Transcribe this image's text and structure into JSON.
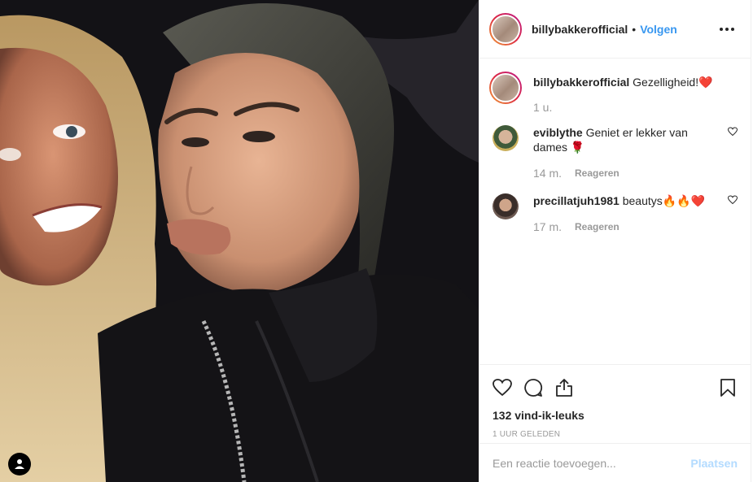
{
  "post": {
    "author": "billybakkerofficial",
    "separator": "•",
    "follow_label": "Volgen",
    "caption": "Gezelligheid!❤️",
    "caption_age": "1 u."
  },
  "comments": [
    {
      "user": "eviblythe",
      "text": "Geniet er lekker van dames 🌹",
      "age": "14 m.",
      "reply_label": "Reageren"
    },
    {
      "user": "precillatjuh1981",
      "text": "beautys🔥🔥❤️",
      "age": "17 m.",
      "reply_label": "Reageren"
    }
  ],
  "stats": {
    "likes": "132 vind-ik-leuks",
    "timestamp": "1 UUR GELEDEN"
  },
  "composer": {
    "placeholder": "Een reactie toevoegen...",
    "post_label": "Plaatsen"
  },
  "colors": {
    "accent": "#3897f0",
    "post_disabled": "#b3dbff",
    "secondary_text": "#999999"
  },
  "icons": [
    "more-options-icon",
    "heart-icon",
    "comment-icon",
    "share-icon",
    "bookmark-icon",
    "user-tag-icon"
  ]
}
